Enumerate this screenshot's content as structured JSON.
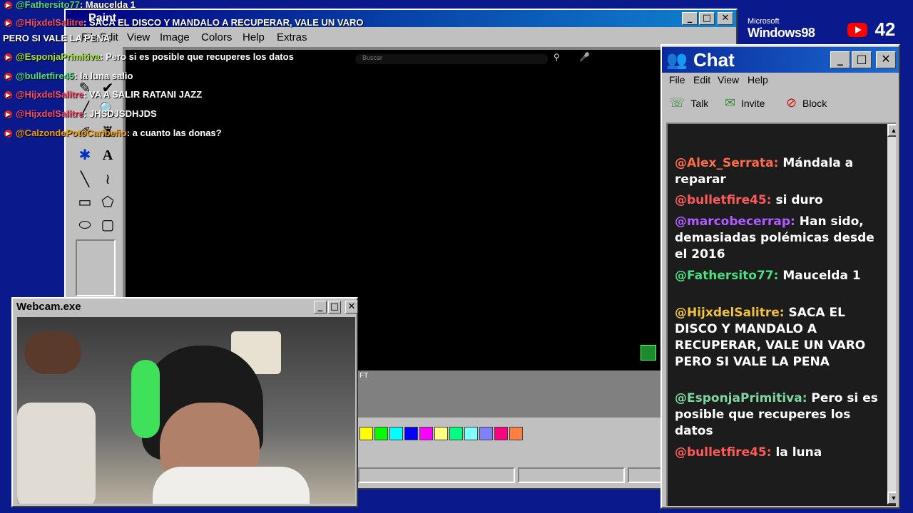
{
  "overlay": {
    "messages": [
      {
        "user": "@Fathersito77",
        "user_color": "#4ade80",
        "text": ": Maucelda 1"
      },
      {
        "user": "@HijxdelSalitre",
        "user_color": "#ff4d6d",
        "text": ": SACA EL DISCO Y MANDALO A RECUPERAR, VALE UN VARO"
      },
      {
        "user": "",
        "user_color": "#ffffff",
        "text": "PERO SI VALE LA PENA"
      },
      {
        "user": "@EsponjaPrimitiva",
        "user_color": "#a3e635",
        "text": ": Pero si es posible que recuperes los datos"
      },
      {
        "user": "@bulletfire45",
        "user_color": "#4ade80",
        "text": ": la luna salio"
      },
      {
        "user": "@HijxdelSalitre",
        "user_color": "#ff4d6d",
        "text": ": VA A SALIR RATANI JAZZ"
      },
      {
        "user": "@HijxdelSalitre",
        "user_color": "#ff4d6d",
        "text": ": JHSDJSDHJDS"
      },
      {
        "user": "@CalzondePotoCaribeño",
        "user_color": "#f59e0b",
        "text": ": a cuanto las donas?"
      }
    ]
  },
  "paint": {
    "title": "Paint",
    "menu": [
      "File",
      "Edit",
      "View",
      "Image",
      "Colors",
      "Help",
      "Extras"
    ],
    "search_placeholder": "Buscar",
    "canvas_label": "FT"
  },
  "branding": {
    "microsoft": "Microsoft",
    "windows": "Windows98"
  },
  "stream": {
    "viewer_count": "42"
  },
  "chat": {
    "title": "Chat",
    "menu": [
      "File",
      "Edit",
      "View",
      "Help"
    ],
    "toolbar": {
      "talk": "Talk",
      "invite": "Invite",
      "block": "Block"
    },
    "messages": [
      {
        "user": "@Alex_Serrata:",
        "color": "#ff6b4a",
        "text": "Mándala a reparar"
      },
      {
        "user": "@bulletfire45:",
        "color": "#ff5a5a",
        "text": "si duro"
      },
      {
        "user": "@marcobecerrap:",
        "color": "#b05cff",
        "text": "Han sido, demasiadas polémicas desde el 2016"
      },
      {
        "user": "@Fathersito77:",
        "color": "#4ade80",
        "text": "Maucelda 1"
      },
      {
        "user": "@HijxdelSalitre:",
        "color": "#f0c040",
        "text": "SACA EL DISCO Y MANDALO A RECUPERAR, VALE UN VARO PERO SI VALE LA PENA"
      },
      {
        "user": "@EsponjaPrimitiva:",
        "color": "#7fd6a0",
        "text": "Pero si es posible que recuperes los datos"
      },
      {
        "user": "@bulletfire45:",
        "color": "#ff5a5a",
        "text": "la luna"
      }
    ]
  },
  "webcam": {
    "title": "Webcam.exe"
  },
  "palette": [
    "#ffff00",
    "#00ff00",
    "#00ffff",
    "#0000ff",
    "#ff00ff",
    "#ffff80",
    "#00ff80",
    "#80ffff",
    "#8080ff",
    "#ff0080",
    "#ff8040"
  ]
}
